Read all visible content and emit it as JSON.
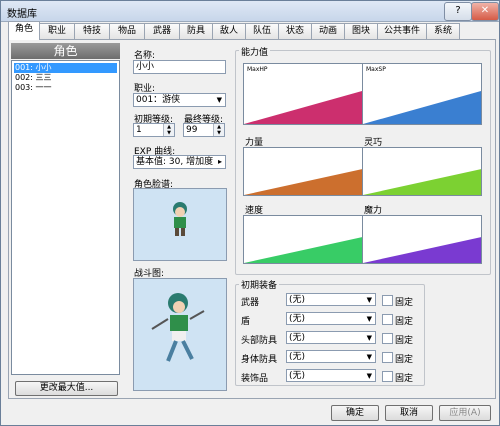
{
  "window": {
    "title": "数据库",
    "help": "?",
    "close": "✕"
  },
  "tabs": [
    {
      "label": "角色",
      "active": true
    },
    {
      "label": "职业"
    },
    {
      "label": "特技"
    },
    {
      "label": "物品"
    },
    {
      "label": "武器"
    },
    {
      "label": "防具"
    },
    {
      "label": "敌人"
    },
    {
      "label": "队伍"
    },
    {
      "label": "状态"
    },
    {
      "label": "动画"
    },
    {
      "label": "图块"
    },
    {
      "label": "公共事件"
    },
    {
      "label": "系统"
    }
  ],
  "list": {
    "header": "角色",
    "items": [
      {
        "label": "001: 小小",
        "selected": true
      },
      {
        "label": "002: 三三"
      },
      {
        "label": "003: 一一"
      }
    ],
    "change_max_button": "更改最大值..."
  },
  "form": {
    "name_label": "名称:",
    "name_value": "小小",
    "class_label": "职业:",
    "class_value": "001：游侠",
    "initial_level_label": "初期等级:",
    "initial_level_value": "1",
    "final_level_label": "最终等级:",
    "final_level_value": "99",
    "exp_label": "EXP 曲线:",
    "exp_value": "基本值: 30, 增加度",
    "face_label": "角色脸谱:",
    "battler_label": "战斗图:"
  },
  "params": {
    "group_label": "能力值",
    "charts": [
      {
        "label": "MaxHP",
        "inside": true,
        "color": "#cc2f6e"
      },
      {
        "label": "MaxSP",
        "inside": true,
        "color": "#3a7fd1"
      },
      {
        "label": "力量",
        "inside": false,
        "color": "#cc6f2e"
      },
      {
        "label": "灵巧",
        "inside": false,
        "color": "#7cd132"
      },
      {
        "label": "速度",
        "inside": false,
        "color": "#38cc66"
      },
      {
        "label": "魔力",
        "inside": false,
        "color": "#7a3ad1"
      }
    ]
  },
  "equipment": {
    "group_label": "初期装备",
    "fixed_label": "固定",
    "rows": [
      {
        "label": "武器",
        "value": "(无)"
      },
      {
        "label": "盾",
        "value": "(无)"
      },
      {
        "label": "头部防具",
        "value": "(无)"
      },
      {
        "label": "身体防具",
        "value": "(无)"
      },
      {
        "label": "装饰品",
        "value": "(无)"
      }
    ]
  },
  "footer": {
    "ok": "确定",
    "cancel": "取消",
    "apply": "应用(A)"
  }
}
